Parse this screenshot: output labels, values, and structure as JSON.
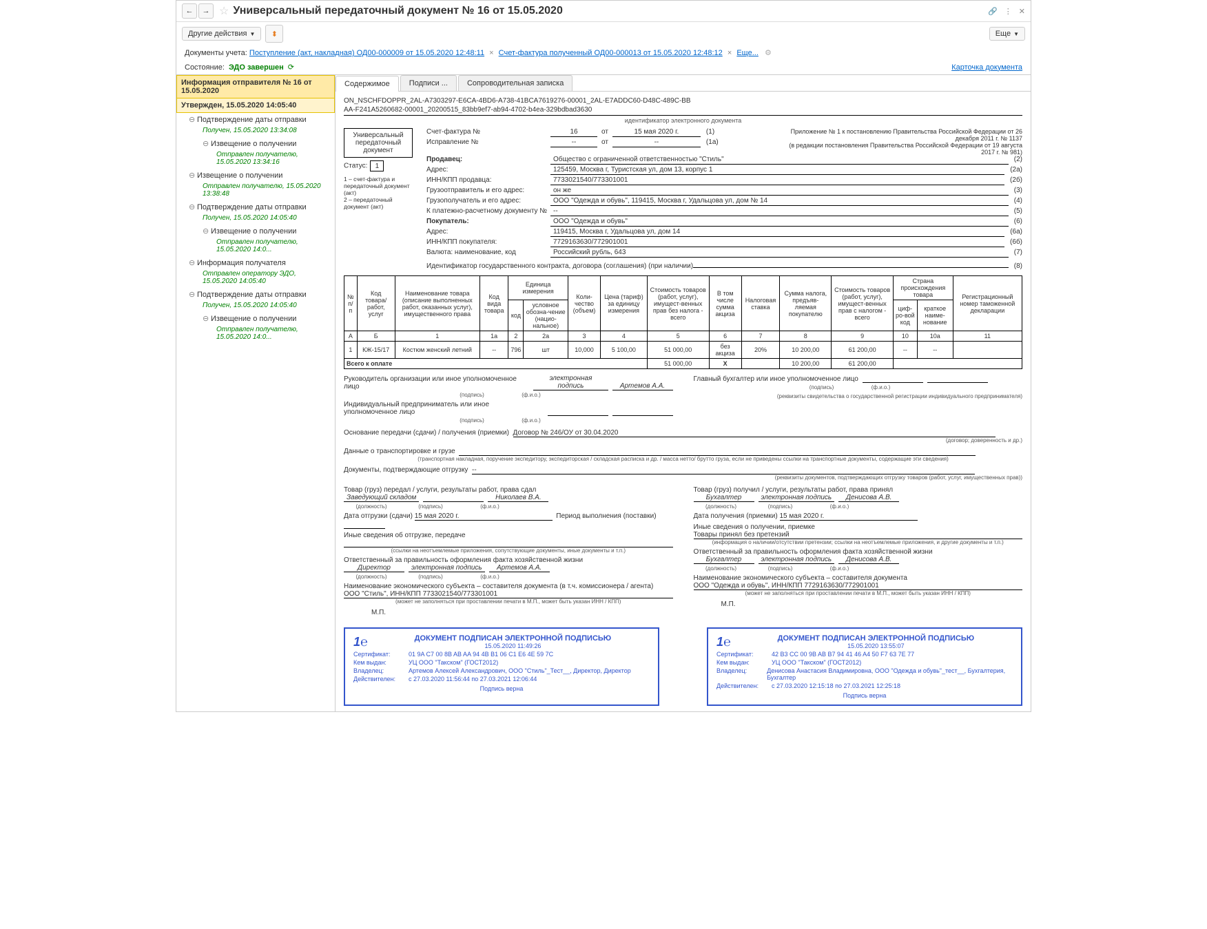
{
  "titlebar": {
    "title": "Универсальный передаточный документ № 16 от 15.05.2020"
  },
  "toolbar": {
    "other_actions": "Другие действия",
    "more": "Еще"
  },
  "doclinks": {
    "label": "Документы учета:",
    "link1": "Поступление (акт, накладная) ОД00-000009 от 15.05.2020 12:48:11",
    "link2": "Счет-фактура полученный ОД00-000013 от 15.05.2020 12:48:12",
    "more": "Еще..."
  },
  "state": {
    "label": "Состояние:",
    "value": "ЭДО завершен",
    "card": "Карточка документа"
  },
  "sidebar": {
    "header": "Информация отправителя № 16 от 15.05.2020",
    "approved": "Утвержден, 15.05.2020 14:05:40",
    "items": [
      {
        "t": "Подтверждение даты отправки",
        "g": "Получен, 15.05.2020 13:34:08",
        "lvl": 1
      },
      {
        "t": "Извещение о получении",
        "g": "Отправлен получателю, 15.05.2020 13:34:16",
        "lvl": 2
      },
      {
        "t": "Извещение о получении",
        "g": "Отправлен получателю, 15.05.2020 13:38:48",
        "lvl": 1
      },
      {
        "t": "Подтверждение даты отправки",
        "g": "Получен, 15.05.2020 14:05:40",
        "lvl": 1
      },
      {
        "t": "Извещение о получении",
        "g": "Отправлен получателю, 15.05.2020 14:0...",
        "lvl": 2
      },
      {
        "t": "Информация получателя",
        "g": "Отправлен оператору ЭДО, 15.05.2020 14:05:40",
        "lvl": 1
      },
      {
        "t": "Подтверждение даты отправки",
        "g": "Получен, 15.05.2020 14:05:40",
        "lvl": 1
      },
      {
        "t": "Извещение о получении",
        "g": "Отправлен получателю, 15.05.2020 14:0...",
        "lvl": 2
      }
    ]
  },
  "tabs": {
    "t1": "Содержимое",
    "t2": "Подписи ...",
    "t3": "Сопроводительная записка"
  },
  "doc": {
    "id1": "ON_NSCHFDOPPR_2AL-A7303297-E6CA-4BD6-A738-41BCA7619276-00001_2AL-E7ADDC60-D48C-489C-BB",
    "id2": "AA-F241A5260682-00001_20200515_83bb9ef7-ab94-4702-b4ea-329bdbad3630",
    "id_cap": "идентификатор электронного документа",
    "upd": "Универсальный передаточный документ",
    "status_lbl": "Статус:",
    "status_val": "1",
    "note": "1 – счет-фактура и передаточный документ (акт)\n2 – передаточный документ (акт)",
    "inv_no_lbl": "Счет-фактура №",
    "inv_no": "16",
    "from": "от",
    "inv_date": "15 мая 2020 г.",
    "n1": "(1)",
    "corr_lbl": "Исправление №",
    "corr_no": "--",
    "corr_date": "--",
    "n1a": "(1а)",
    "right_note1": "Приложение № 1 к постановлению Правительства Российской Федерации от 26 декабря 2011 г. № 1137",
    "right_note2": "(в редакции постановления Правительства Российской Федерации от 19 августа 2017 г. № 981)",
    "fields": [
      {
        "l": "Продавец:",
        "v": "Общество с ограниченной ответственностью \"Стиль\"",
        "n": "(2)"
      },
      {
        "l": "Адрес:",
        "v": "125459, Москва г, Туристская ул, дом 13, корпус 1",
        "n": "(2а)"
      },
      {
        "l": "ИНН/КПП продавца:",
        "v": "7733021540/773301001",
        "n": "(2б)"
      },
      {
        "l": "Грузоотправитель и его адрес:",
        "v": "он же",
        "n": "(3)"
      },
      {
        "l": "Грузополучатель и его адрес:",
        "v": "ООО \"Одежда и обувь\", 119415, Москва г, Удальцова ул, дом № 14",
        "n": "(4)"
      },
      {
        "l": "К платежно-расчетному документу №",
        "v": "--",
        "n": "(5)"
      },
      {
        "l": "Покупатель:",
        "v": "ООО \"Одежда и обувь\"",
        "n": "(6)"
      },
      {
        "l": "Адрес:",
        "v": "119415, Москва г, Удальцова ул, дом 14",
        "n": "(6а)"
      },
      {
        "l": "ИНН/КПП покупателя:",
        "v": "7729163630/772901001",
        "n": "(6б)"
      },
      {
        "l": "Валюта: наименование, код",
        "v": "Российский рубль, 643",
        "n": "(7)"
      },
      {
        "l": "Идентификатор государственного контракта, договора (соглашения) (при наличии)",
        "v": "",
        "n": "(8)"
      }
    ]
  },
  "chart_data": {
    "type": "table",
    "headers_row1": [
      "№ п/п",
      "Код товара/ работ, услуг",
      "Наименование товара (описание выполненных работ, оказанных услуг), имущественного права",
      "Код вида товара",
      "Единица измерения",
      "",
      "Коли-чество (объем)",
      "Цена (тариф) за единицу измерения",
      "Стоимость товаров (работ, услуг), имущест-венных прав без налога - всего",
      "В том числе сумма акциза",
      "Налоговая ставка",
      "Сумма налога, предъяв-ляемая покупателю",
      "Стоимость товаров (работ, услуг), имущест-венных прав с налогом - всего",
      "Страна происхождения товара",
      "",
      "Регистрационный номер таможенной декларации"
    ],
    "headers_row2": [
      "",
      "",
      "",
      "",
      "код",
      "условное обозна-чение (нацио-нальное)",
      "",
      "",
      "",
      "",
      "",
      "",
      "",
      "циф-ро-вой код",
      "краткое наиме-нование",
      ""
    ],
    "num_row": [
      "А",
      "Б",
      "1",
      "1а",
      "2",
      "2а",
      "3",
      "4",
      "5",
      "6",
      "7",
      "8",
      "9",
      "10",
      "10а",
      "11"
    ],
    "rows": [
      [
        "1",
        "КЖ-15/17",
        "Костюм женский летний",
        "--",
        "796",
        "шт",
        "10,000",
        "5 100,00",
        "51 000,00",
        "без акциза",
        "20%",
        "10 200,00",
        "61 200,00",
        "--",
        "--",
        ""
      ]
    ],
    "total": [
      "Всего к оплате",
      "",
      "",
      "",
      "",
      "",
      "",
      "",
      "51 000,00",
      "Х",
      "",
      "10 200,00",
      "61 200,00",
      "",
      "",
      ""
    ]
  },
  "sig": {
    "head_lbl": "Руководитель организации или иное уполномоченное лицо",
    "esign": "электронная подпись",
    "artemov": "Артемов А.А.",
    "acc_lbl": "Главный бухгалтер или иное уполномоченное лицо",
    "ip_lbl": "Индивидуальный предприниматель или иное уполномоченное лицо",
    "ip_note": "(реквизиты свидетельства о государственной регистрации индивидуального предпринимателя)",
    "podpis_cap": "(подпись)",
    "fio_cap": "(ф.и.о.)"
  },
  "bottom": {
    "basis_lbl": "Основание передачи (сдачи) / получения (приемки)",
    "basis_val": "Договор № 246/ОУ от 30.04.2020",
    "basis_cap": "(договор; доверенность и др.)",
    "trans_lbl": "Данные о транспортировке и грузе",
    "trans_cap": "(транспортная накладная, поручение экспедитору, экспедиторская / складская расписка и др. / масса нетто/ брутто груза, если не приведены ссылки на транспортные документы, содержащие эти сведения)",
    "ship_lbl": "Документы, подтверждающие отгрузку",
    "ship_val": "--",
    "ship_cap": "(реквизиты документов, подтверждающих отгрузку товаров (работ, услуг, имущественных прав))",
    "left": {
      "gave": "Товар (груз) передал / услуги, результаты работ, права сдал",
      "pos": "Заведующий складом",
      "name": "Николаев В.А.",
      "date_lbl": "Дата отгрузки (сдачи)",
      "date": "15 мая 2020 г.",
      "period": "Период выполнения (поставки)",
      "other": "Иные сведения об отгрузке, передаче",
      "other_cap": "(ссылки на неотъемлемые приложения, сопутствующие документы, иные документы и т.п.)",
      "resp": "Ответственный за правильность оформления факта хозяйственной жизни",
      "dir": "Директор",
      "dir_name": "Артемов А.А.",
      "org_lbl": "Наименование экономического субъекта – составителя документа (в т.ч. комиссионера / агента)",
      "org": "ООО \"Стиль\", ИНН/КПП 7733021540/773301001",
      "org_cap": "(может не заполняться при проставлении печати в М.П., может быть указан ИНН / КПП)",
      "mp": "М.П."
    },
    "right": {
      "got": "Товар (груз) получил / услуги, результаты работ, права принял",
      "pos": "Бухгалтер",
      "name": "Денисова А.В.",
      "date_lbl": "Дата получения (приемки)",
      "date": "15 мая 2020 г.",
      "other": "Иные сведения о получении, приемке",
      "claim": "Товары принял без претензий",
      "claim_cap": "(информация о наличии/отсутствии претензии; ссылки на неотъемлемые приложения, и другие документы и т.п.)",
      "resp": "Ответственный за правильность оформления факта хозяйственной жизни",
      "pos2": "Бухгалтер",
      "name2": "Денисова А.В.",
      "org_lbl": "Наименование экономического субъекта – составителя документа",
      "org": "ООО \"Одежда и обувь\", ИНН/КПП 7729163630/772901001",
      "org_cap": "(может не заполняться при проставлении печати в М.П., может быть указан ИНН / КПП)",
      "mp": "М.П."
    }
  },
  "stamps": {
    "title": "ДОКУМЕНТ ПОДПИСАН ЭЛЕКТРОННОЙ ПОДПИСЬЮ",
    "cert_k": "Сертификат:",
    "issued_k": "Кем выдан:",
    "owner_k": "Владелец:",
    "valid_k": "Действителен:",
    "verified": "Подпись верна",
    "left": {
      "date": "15.05.2020 11:49:26",
      "cert": "01 9A C7 00 8B AB AA 94 4B B1 06 C1 E6 4E 59 7C",
      "issued": "УЦ ООО \"Такском\" (ГОСТ2012)",
      "owner": "Артемов Алексей Александрович, ООО \"Стиль\"_Тест__, Директор, Директор",
      "valid": "с 27.03.2020 11:56:44 по 27.03.2021 12:06:44"
    },
    "right": {
      "date": "15.05.2020 13:55:07",
      "cert": "42 B3 CC 00 9B AB B7 94 41 46 A4 50 F7 63 7E 77",
      "issued": "УЦ ООО \"Такском\" (ГОСТ2012)",
      "owner": "Денисова Анастасия Владимировна, ООО \"Одежда и обувь\"_тест__, Бухгалтерия, Бухгалтер",
      "valid": "с 27.03.2020 12:15:18 по 27.03.2021 12:25:18"
    }
  },
  "caps": {
    "dolzh": "(должность)"
  }
}
